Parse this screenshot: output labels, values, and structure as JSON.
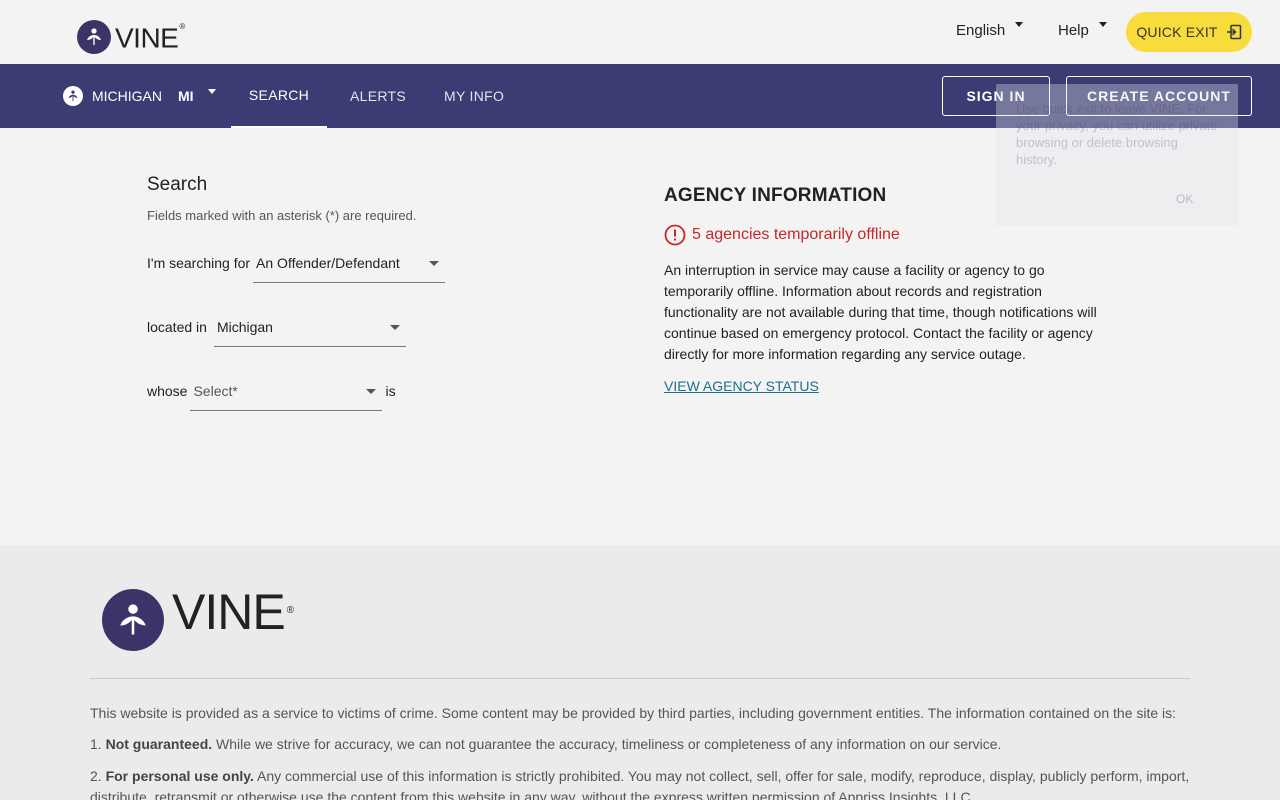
{
  "header": {
    "logo_text": "VINE",
    "logo_reg": "®",
    "language": "English",
    "help": "Help",
    "quick_exit": "QUICK EXIT"
  },
  "nav": {
    "state_name": "MICHIGAN",
    "state_abbr": "MI",
    "tabs": [
      {
        "label": "SEARCH",
        "active": true
      },
      {
        "label": "ALERTS",
        "active": false
      },
      {
        "label": "MY INFO",
        "active": false
      }
    ],
    "sign_in": "SIGN IN",
    "create_account": "CREATE ACCOUNT"
  },
  "tooltip": {
    "text": "Use quick exit to leave VINE. For your privacy, you can utilize private browsing or delete browsing history.",
    "ok": "OK"
  },
  "search": {
    "title": "Search",
    "note": "Fields marked with an asterisk (*) are required.",
    "row1_label": "I'm searching for",
    "row1_value": "An Offender/Defendant",
    "row2_label": "located in",
    "row2_value": "Michigan",
    "row3_label": "whose",
    "row3_placeholder": "Select*",
    "row3_suffix": "is"
  },
  "agency": {
    "title": "AGENCY INFORMATION",
    "warning": "5 agencies temporarily offline",
    "description": "An interruption in service may cause a facility or agency to go temporarily offline. Information about records and registration functionality are not available during that time, though notifications will continue based on emergency protocol. Contact the facility or agency directly for more information regarding any service outage.",
    "link": "VIEW AGENCY STATUS"
  },
  "footer": {
    "logo_text": "VINE",
    "logo_reg": "®",
    "intro": "This website is provided as a service to victims of crime. Some content may be provided by third parties, including government entities. The information contained on the site is:",
    "item1_num": "1.",
    "item1_bold": "Not guaranteed.",
    "item1_text": "While we strive for accuracy, we can not guarantee the accuracy, timeliness or completeness of any information on our service.",
    "item2_num": "2.",
    "item2_bold": "For personal use only.",
    "item2_text": "Any commercial use of this information is strictly prohibited. You may not collect, sell, offer for sale, modify, reproduce, display, publicly perform, import, distribute, retransmit or otherwise use the content from this website in any way, without the express written permission of Appriss Insights, LLC."
  },
  "colors": {
    "nav_bg": "#3b3c73",
    "logo_purple": "#3c3468",
    "quick_exit_bg": "#f7dc3c",
    "warning_red": "#c62828",
    "link_teal": "#1f6f8b"
  }
}
